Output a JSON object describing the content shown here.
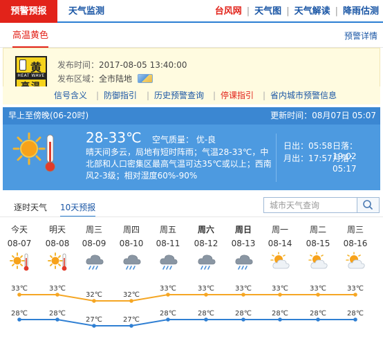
{
  "topbar": {
    "warning_tab": "预警预报",
    "monitor_tab": "天气监测",
    "links": [
      {
        "label": "台风网",
        "color": "red"
      },
      {
        "label": "天气图",
        "color": "blue"
      },
      {
        "label": "天气解读",
        "color": "blue"
      },
      {
        "label": "降雨估测",
        "color": "blue"
      }
    ]
  },
  "warning": {
    "title": "高温黄色",
    "details_link": "预警详情",
    "badge": {
      "top": "黄",
      "band": "HEAT WAVE",
      "bottom": "高温"
    },
    "time_label": "发布时间：",
    "time_value": "2017-08-05 13:40:00",
    "region_label": "发布区域：",
    "region_value": "全市陆地",
    "links": [
      {
        "label": "信号含义",
        "color": "blue"
      },
      {
        "label": "防御指引",
        "color": "blue"
      },
      {
        "label": "历史预警查询",
        "color": "blue"
      },
      {
        "label": "停课指引",
        "color": "red"
      },
      {
        "label": "省内城市预警信息",
        "color": "blue"
      }
    ]
  },
  "forecast": {
    "period": "早上至傍晚(06-20时)",
    "update": "更新时间：08月07日 05:07",
    "temp": "28-33℃",
    "air_quality": "空气质量：  优-良",
    "description": "晴天间多云，局地有短时阵雨；气温28-33℃，中北部和人口密集区最高气温可达35℃或以上；西南风2-3级；相对湿度60%-90%",
    "sunrise": "日出：05:58",
    "sunset": "日落：19:02",
    "moonrise": "月出：17:57",
    "moonset": "月落：05:17"
  },
  "tabs": {
    "hourly": "逐时天气",
    "ten_day": "10天预报"
  },
  "search": {
    "placeholder": "城市天气查询"
  },
  "days": [
    {
      "name": "今天",
      "date": "08-07",
      "icon": "sunny-hot-icon",
      "bold": false
    },
    {
      "name": "明天",
      "date": "08-08",
      "icon": "sunny-hot-icon",
      "bold": false
    },
    {
      "name": "周三",
      "date": "08-09",
      "icon": "cloud-rain-icon",
      "bold": false
    },
    {
      "name": "周四",
      "date": "08-10",
      "icon": "cloud-rain-icon",
      "bold": false
    },
    {
      "name": "周五",
      "date": "08-11",
      "icon": "cloud-rain-icon",
      "bold": false
    },
    {
      "name": "周六",
      "date": "08-12",
      "icon": "cloud-rain-icon",
      "bold": true
    },
    {
      "name": "周日",
      "date": "08-13",
      "icon": "cloud-rain-icon",
      "bold": true
    },
    {
      "name": "周一",
      "date": "08-14",
      "icon": "partly-cloudy-icon",
      "bold": false
    },
    {
      "name": "周二",
      "date": "08-15",
      "icon": "partly-cloudy-icon",
      "bold": false
    },
    {
      "name": "周三",
      "date": "08-16",
      "icon": "partly-cloudy-icon",
      "bold": false
    }
  ],
  "chart_data": {
    "type": "line",
    "categories": [
      "08-07",
      "08-08",
      "08-09",
      "08-10",
      "08-11",
      "08-12",
      "08-13",
      "08-14",
      "08-15",
      "08-16"
    ],
    "series": [
      {
        "values": [
          33,
          33,
          32,
          32,
          33,
          33,
          33,
          33,
          33,
          33
        ],
        "color": "#f5a623"
      },
      {
        "values": [
          28,
          28,
          27,
          27,
          28,
          28,
          28,
          28,
          28,
          28
        ],
        "color": "#2f7fd3"
      }
    ],
    "labels_high": [
      "33℃",
      "33℃",
      "32℃",
      "32℃",
      "33℃",
      "33℃",
      "33℃",
      "33℃",
      "33℃",
      "33℃"
    ],
    "labels_low": [
      "28℃",
      "28℃",
      "27℃",
      "27℃",
      "28℃",
      "28℃",
      "28℃",
      "28℃",
      "28℃",
      "28℃"
    ]
  },
  "colors": {
    "accent_red": "#e2231a",
    "link_blue": "#1a56a5",
    "panel_blue": "#4d9ae0",
    "high_line": "#f5a623",
    "low_line": "#2f7fd3"
  }
}
